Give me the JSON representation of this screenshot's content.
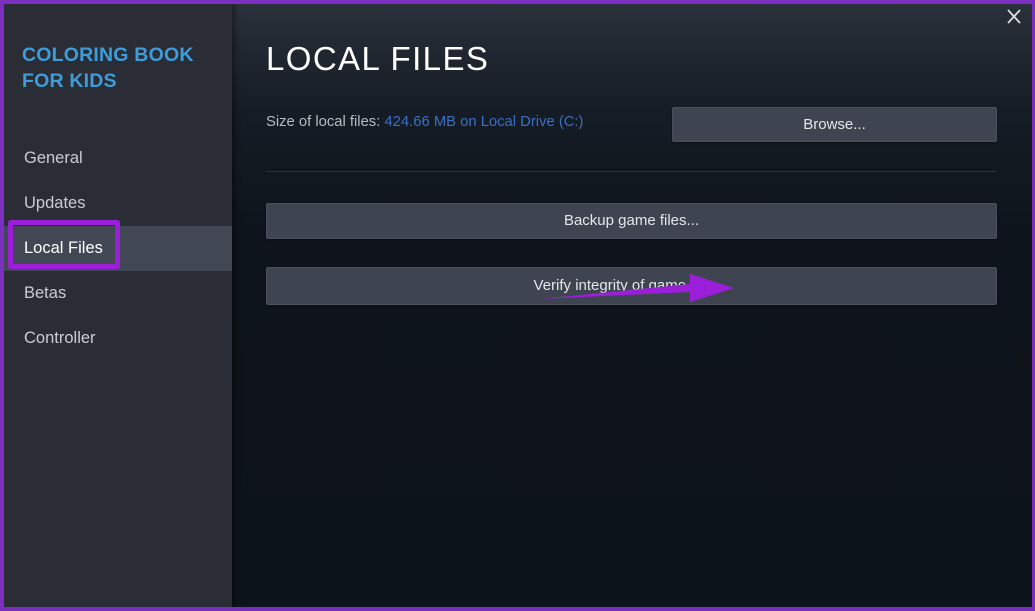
{
  "window": {
    "close_icon": "close-icon",
    "accent_border_color": "#7b2fbe"
  },
  "sidebar": {
    "game_title": "COLORING BOOK FOR KIDS",
    "title_color": "#3d9ddb",
    "items": [
      {
        "label": "General",
        "selected": false
      },
      {
        "label": "Updates",
        "selected": false
      },
      {
        "label": "Local Files",
        "selected": true
      },
      {
        "label": "Betas",
        "selected": false
      },
      {
        "label": "Controller",
        "selected": false
      }
    ]
  },
  "main": {
    "page_title": "LOCAL FILES",
    "size_label": "Size of local files:",
    "size_value": "424.66 MB on Local Drive (C:)",
    "size_value_color": "#3a6fc4",
    "buttons": {
      "browse": "Browse...",
      "backup": "Backup game files...",
      "verify": "Verify integrity of game files..."
    }
  },
  "annotations": {
    "highlight_color": "#9b1fd8",
    "arrow_color": "#9b1fd8",
    "highlight_target": "Local Files",
    "arrow_target": "Verify integrity of game files..."
  }
}
